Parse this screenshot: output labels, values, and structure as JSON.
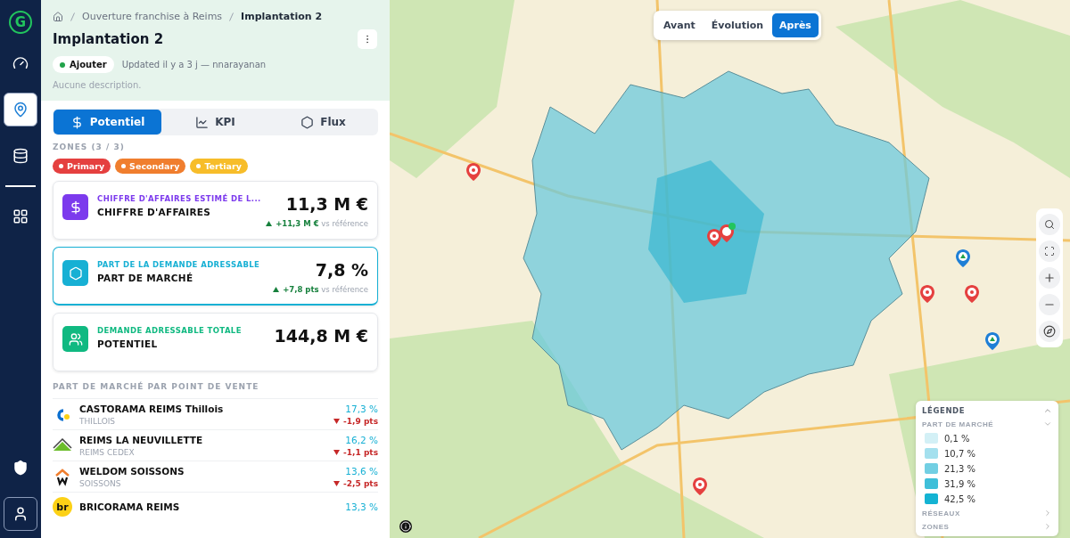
{
  "sidebar": {
    "logo": "G",
    "items": [
      {
        "kind": "gauge",
        "selected": false
      },
      {
        "kind": "pin",
        "selected": true
      },
      {
        "kind": "database",
        "selected": false
      },
      {
        "kind": "grid",
        "selected": false
      }
    ],
    "bottom_items": [
      {
        "kind": "shield",
        "selected": false
      },
      {
        "kind": "user",
        "selected": true
      }
    ]
  },
  "breadcrumb": [
    "Ouverture franchise à Reims",
    "Implantation 2"
  ],
  "title": "Implantation 2",
  "status": {
    "label": "Ajouter",
    "color": "#22a34a"
  },
  "updated": "Updated il y a 3 j — nnarayanan",
  "description": "Aucune description.",
  "tabs": [
    {
      "label": "Potentiel",
      "kind": "dollar",
      "selected": true
    },
    {
      "label": "KPI",
      "kind": "chart",
      "selected": false
    },
    {
      "label": "Flux",
      "kind": "hexagon",
      "selected": false
    }
  ],
  "zones": {
    "label": "ZONES (3 / 3)",
    "items": [
      {
        "label": "Primary",
        "color": "#e5403f"
      },
      {
        "label": "Secondary",
        "color": "#f07e2e"
      },
      {
        "label": "Tertiary",
        "color": "#f7bd2a"
      }
    ]
  },
  "cards": [
    {
      "kind": "dollar",
      "color": "#7c3aed",
      "caption": "CHIFFRE D'AFFAIRES ESTIMÉ DE L...",
      "title": "CHIFFRE D'AFFAIRES",
      "value": "11,3 M €",
      "delta": "+11,3 M €",
      "delta_note": "vs référence",
      "selected": false
    },
    {
      "kind": "hexagon",
      "color": "#17b0d4",
      "caption": "PART DE LA DEMANDE ADRESSABLE",
      "title": "PART DE MARCHÉ",
      "value": "7,8 %",
      "delta": "+7,8 pts",
      "delta_note": "vs référence",
      "selected": true
    },
    {
      "kind": "people",
      "color": "#10b981",
      "caption": "DEMANDE ADRESSABLE TOTALE",
      "title": "POTENTIEL",
      "value": "144,8 M €",
      "selected": false
    }
  ],
  "stores": {
    "title": "PART DE MARCHÉ PAR POINT DE VENTE",
    "rows": [
      {
        "kind": "dot",
        "name": "CASTORAMA REIMS Thillois",
        "city": "THILLOIS",
        "share": "17,3 %",
        "delta": "-1,9 pts",
        "decrease": true
      },
      {
        "kind": "roof",
        "name": "REIMS LA NEUVILLETTE",
        "city": "REIMS CEDEX",
        "share": "16,2 %",
        "delta": "-1,1 pts",
        "decrease": true
      },
      {
        "kind": "house",
        "name": "WELDOM SOISSONS",
        "city": "SOISSONS",
        "share": "13,6 %",
        "delta": "-2,5 pts",
        "decrease": true
      },
      {
        "kind": "letters",
        "logo_text": "br",
        "name": "BRICORAMA REIMS",
        "share": "13,3 %"
      }
    ]
  },
  "map": {
    "view_toggle": [
      {
        "label": "Avant",
        "selected": false
      },
      {
        "label": "Évolution",
        "selected": false
      },
      {
        "label": "Après",
        "selected": true
      }
    ],
    "pins": [
      {
        "kind": "store",
        "color": "#e5403f"
      },
      {
        "kind": "store",
        "color": "#e5403f"
      },
      {
        "kind": "new",
        "color": "#e5403f"
      },
      {
        "kind": "store",
        "color": "#e5403f"
      },
      {
        "kind": "other",
        "color": "#1e7fd6"
      },
      {
        "kind": "store",
        "color": "#e5403f"
      },
      {
        "kind": "other",
        "color": "#1e7fd6"
      },
      {
        "kind": "store",
        "color": "#e5403f"
      }
    ],
    "legend": {
      "title": "LÉGENDE",
      "expanded": true,
      "sections": [
        {
          "title": "PART DE MARCHÉ",
          "expanded": true,
          "items": [
            {
              "label": "0,1 %",
              "color": "#d3f0f6"
            },
            {
              "label": "10,7 %",
              "color": "#a4e0ee"
            },
            {
              "label": "21,3 %",
              "color": "#72cfe3"
            },
            {
              "label": "31,9 %",
              "color": "#3fbfd9"
            },
            {
              "label": "42,5 %",
              "color": "#14b3d3"
            }
          ]
        },
        {
          "title": "RÉSEAUX",
          "expanded": false
        },
        {
          "title": "ZONES",
          "expanded": false
        }
      ]
    }
  }
}
